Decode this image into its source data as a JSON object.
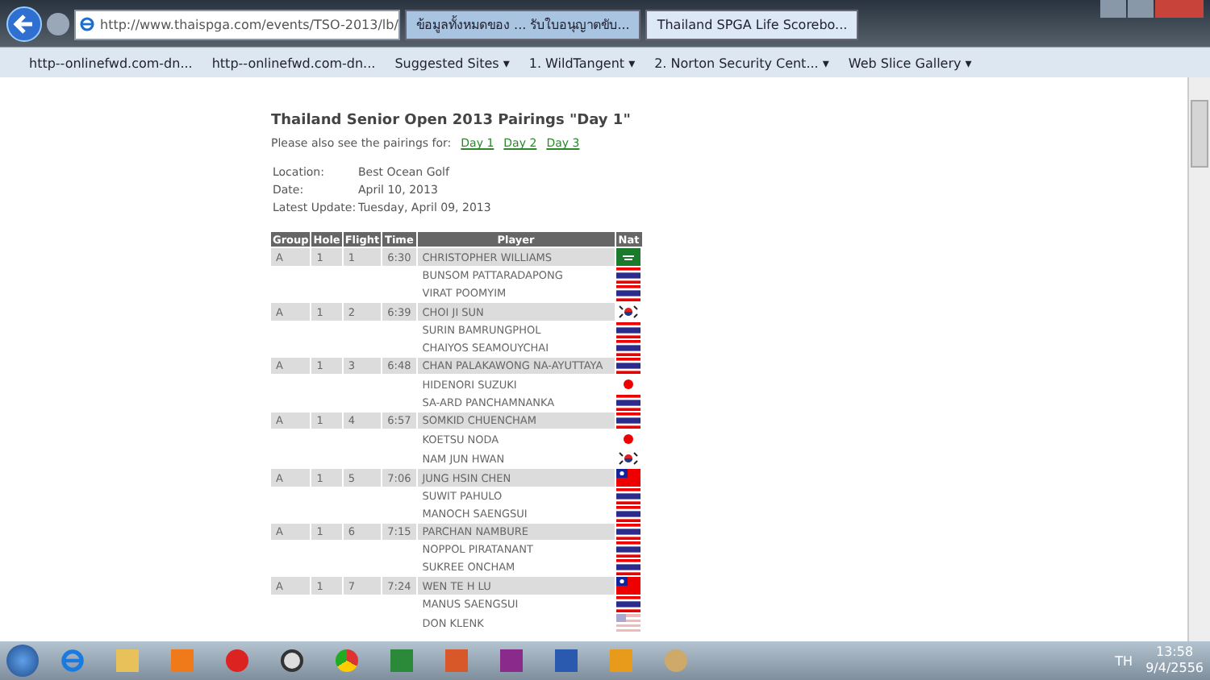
{
  "browser": {
    "address": "http://www.thaispga.com/events/TSO-2013/lb/",
    "tabs": [
      {
        "label": "ข้อมูลทั้งหมดของ ... รับใบอนุญาตขับ...",
        "selected": false
      },
      {
        "label": "Thailand SPGA Life Scorebo...",
        "selected": true
      }
    ],
    "favorites": [
      "http--onlinefwd.com-dn...",
      "http--onlinefwd.com-dn...",
      "Suggested Sites ▾",
      "1. WildTangent ▾",
      "2. Norton Security Cent... ▾",
      "Web Slice Gallery ▾"
    ]
  },
  "page": {
    "title": "Thailand Senior Open 2013 Pairings \"Day 1\"",
    "see_also": "Please also see the pairings for:",
    "day_links": [
      "Day 1",
      "Day 2",
      "Day 3"
    ],
    "info": [
      {
        "label": "Location:",
        "value": "Best Ocean Golf"
      },
      {
        "label": "Date:",
        "value": "April 10, 2013"
      },
      {
        "label": "Latest Update:",
        "value": "Tuesday, April 09, 2013"
      }
    ],
    "columns": [
      "Group",
      "Hole",
      "Flight",
      "Time",
      "Player",
      "Nat"
    ],
    "groups": [
      {
        "group": "A",
        "hole": "1",
        "flight": "1",
        "time": "6:30",
        "players": [
          {
            "name": "CHRISTOPHER WILLIAMS",
            "kind": "green"
          },
          {
            "name": "BUNSOM PATTARADAPONG",
            "kind": "striped"
          },
          {
            "name": "VIRAT POOMYIM",
            "kind": "striped"
          }
        ]
      },
      {
        "group": "A",
        "hole": "1",
        "flight": "2",
        "time": "6:39",
        "players": [
          {
            "name": "CHOI JI SUN",
            "kind": "taegeuk"
          },
          {
            "name": "SURIN BAMRUNGPHOL",
            "kind": "striped"
          },
          {
            "name": "CHAIYOS SEAMOUYCHAI",
            "kind": "striped"
          }
        ]
      },
      {
        "group": "A",
        "hole": "1",
        "flight": "3",
        "time": "6:48",
        "players": [
          {
            "name": "CHAN PALAKAWONG NA-AYUTTAYA",
            "kind": "striped"
          },
          {
            "name": "HIDENORI SUZUKI",
            "kind": "disc"
          },
          {
            "name": "SA-ARD PANCHAMNANKA",
            "kind": "striped"
          }
        ]
      },
      {
        "group": "A",
        "hole": "1",
        "flight": "4",
        "time": "6:57",
        "players": [
          {
            "name": "SOMKID CHUENCHAM",
            "kind": "striped"
          },
          {
            "name": "KOETSU NODA",
            "kind": "disc"
          },
          {
            "name": "NAM JUN HWAN",
            "kind": "taegeuk"
          }
        ]
      },
      {
        "group": "A",
        "hole": "1",
        "flight": "5",
        "time": "7:06",
        "players": [
          {
            "name": "JUNG HSIN CHEN",
            "kind": "canton"
          },
          {
            "name": "SUWIT PAHULO",
            "kind": "striped"
          },
          {
            "name": "MANOCH SAENGSUI",
            "kind": "striped"
          }
        ]
      },
      {
        "group": "A",
        "hole": "1",
        "flight": "6",
        "time": "7:15",
        "players": [
          {
            "name": "PARCHAN NAMBURE",
            "kind": "striped"
          },
          {
            "name": "NOPPOL PIRATANANT",
            "kind": "striped"
          },
          {
            "name": "SUKREE ONCHAM",
            "kind": "striped"
          }
        ]
      },
      {
        "group": "A",
        "hole": "1",
        "flight": "7",
        "time": "7:24",
        "players": [
          {
            "name": "WEN TE H LU",
            "kind": "canton"
          },
          {
            "name": "MANUS SAENGSUI",
            "kind": "striped"
          },
          {
            "name": "DON KLENK",
            "kind": "stripes-pale"
          }
        ]
      }
    ]
  },
  "taskbar": {
    "language": "TH",
    "time": "13:58",
    "date": "9/4/2556"
  }
}
